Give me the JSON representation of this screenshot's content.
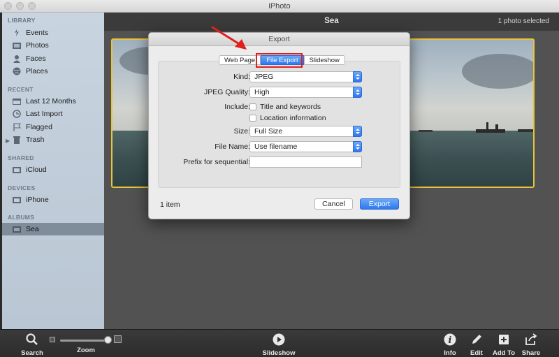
{
  "window": {
    "title": "iPhoto"
  },
  "sidebar": {
    "sections": [
      {
        "label": "LIBRARY",
        "items": [
          {
            "label": "Events",
            "icon": "events-icon"
          },
          {
            "label": "Photos",
            "icon": "photos-icon"
          },
          {
            "label": "Faces",
            "icon": "faces-icon"
          },
          {
            "label": "Places",
            "icon": "places-icon"
          }
        ]
      },
      {
        "label": "RECENT",
        "items": [
          {
            "label": "Last 12 Months",
            "icon": "calendar-icon"
          },
          {
            "label": "Last Import",
            "icon": "import-icon"
          },
          {
            "label": "Flagged",
            "icon": "flag-icon"
          },
          {
            "label": "Trash",
            "icon": "trash-icon"
          }
        ]
      },
      {
        "label": "SHARED",
        "items": [
          {
            "label": "iCloud",
            "icon": "icloud-icon"
          }
        ]
      },
      {
        "label": "DEVICES",
        "items": [
          {
            "label": "iPhone",
            "icon": "iphone-icon"
          }
        ]
      },
      {
        "label": "ALBUMS",
        "items": [
          {
            "label": "Sea",
            "icon": "album-icon",
            "selected": true
          }
        ]
      }
    ]
  },
  "main": {
    "album_title": "Sea",
    "selection_count": "1 photo selected"
  },
  "dialog": {
    "title": "Export",
    "tabs": [
      {
        "label": "Web Page",
        "active": false
      },
      {
        "label": "File Export",
        "active": true
      },
      {
        "label": "Slideshow",
        "active": false
      }
    ],
    "fields": {
      "kind": {
        "label": "Kind:",
        "value": "JPEG"
      },
      "quality": {
        "label": "JPEG Quality:",
        "value": "High"
      },
      "include": {
        "label": "Include:",
        "options": [
          "Title and keywords",
          "Location information"
        ]
      },
      "size": {
        "label": "Size:",
        "value": "Full Size"
      },
      "filename": {
        "label": "File Name:",
        "value": "Use filename"
      },
      "prefix": {
        "label": "Prefix for sequential:",
        "value": ""
      }
    },
    "item_count": "1 item",
    "cancel_label": "Cancel",
    "export_label": "Export"
  },
  "toolbar": {
    "search": "Search",
    "zoom": "Zoom",
    "slideshow": "Slideshow",
    "info": "Info",
    "edit": "Edit",
    "add_to": "Add To",
    "share": "Share"
  },
  "colors": {
    "highlight": "#e0201c",
    "accent": "#2f78ee",
    "selection_border": "#e8c33c"
  }
}
